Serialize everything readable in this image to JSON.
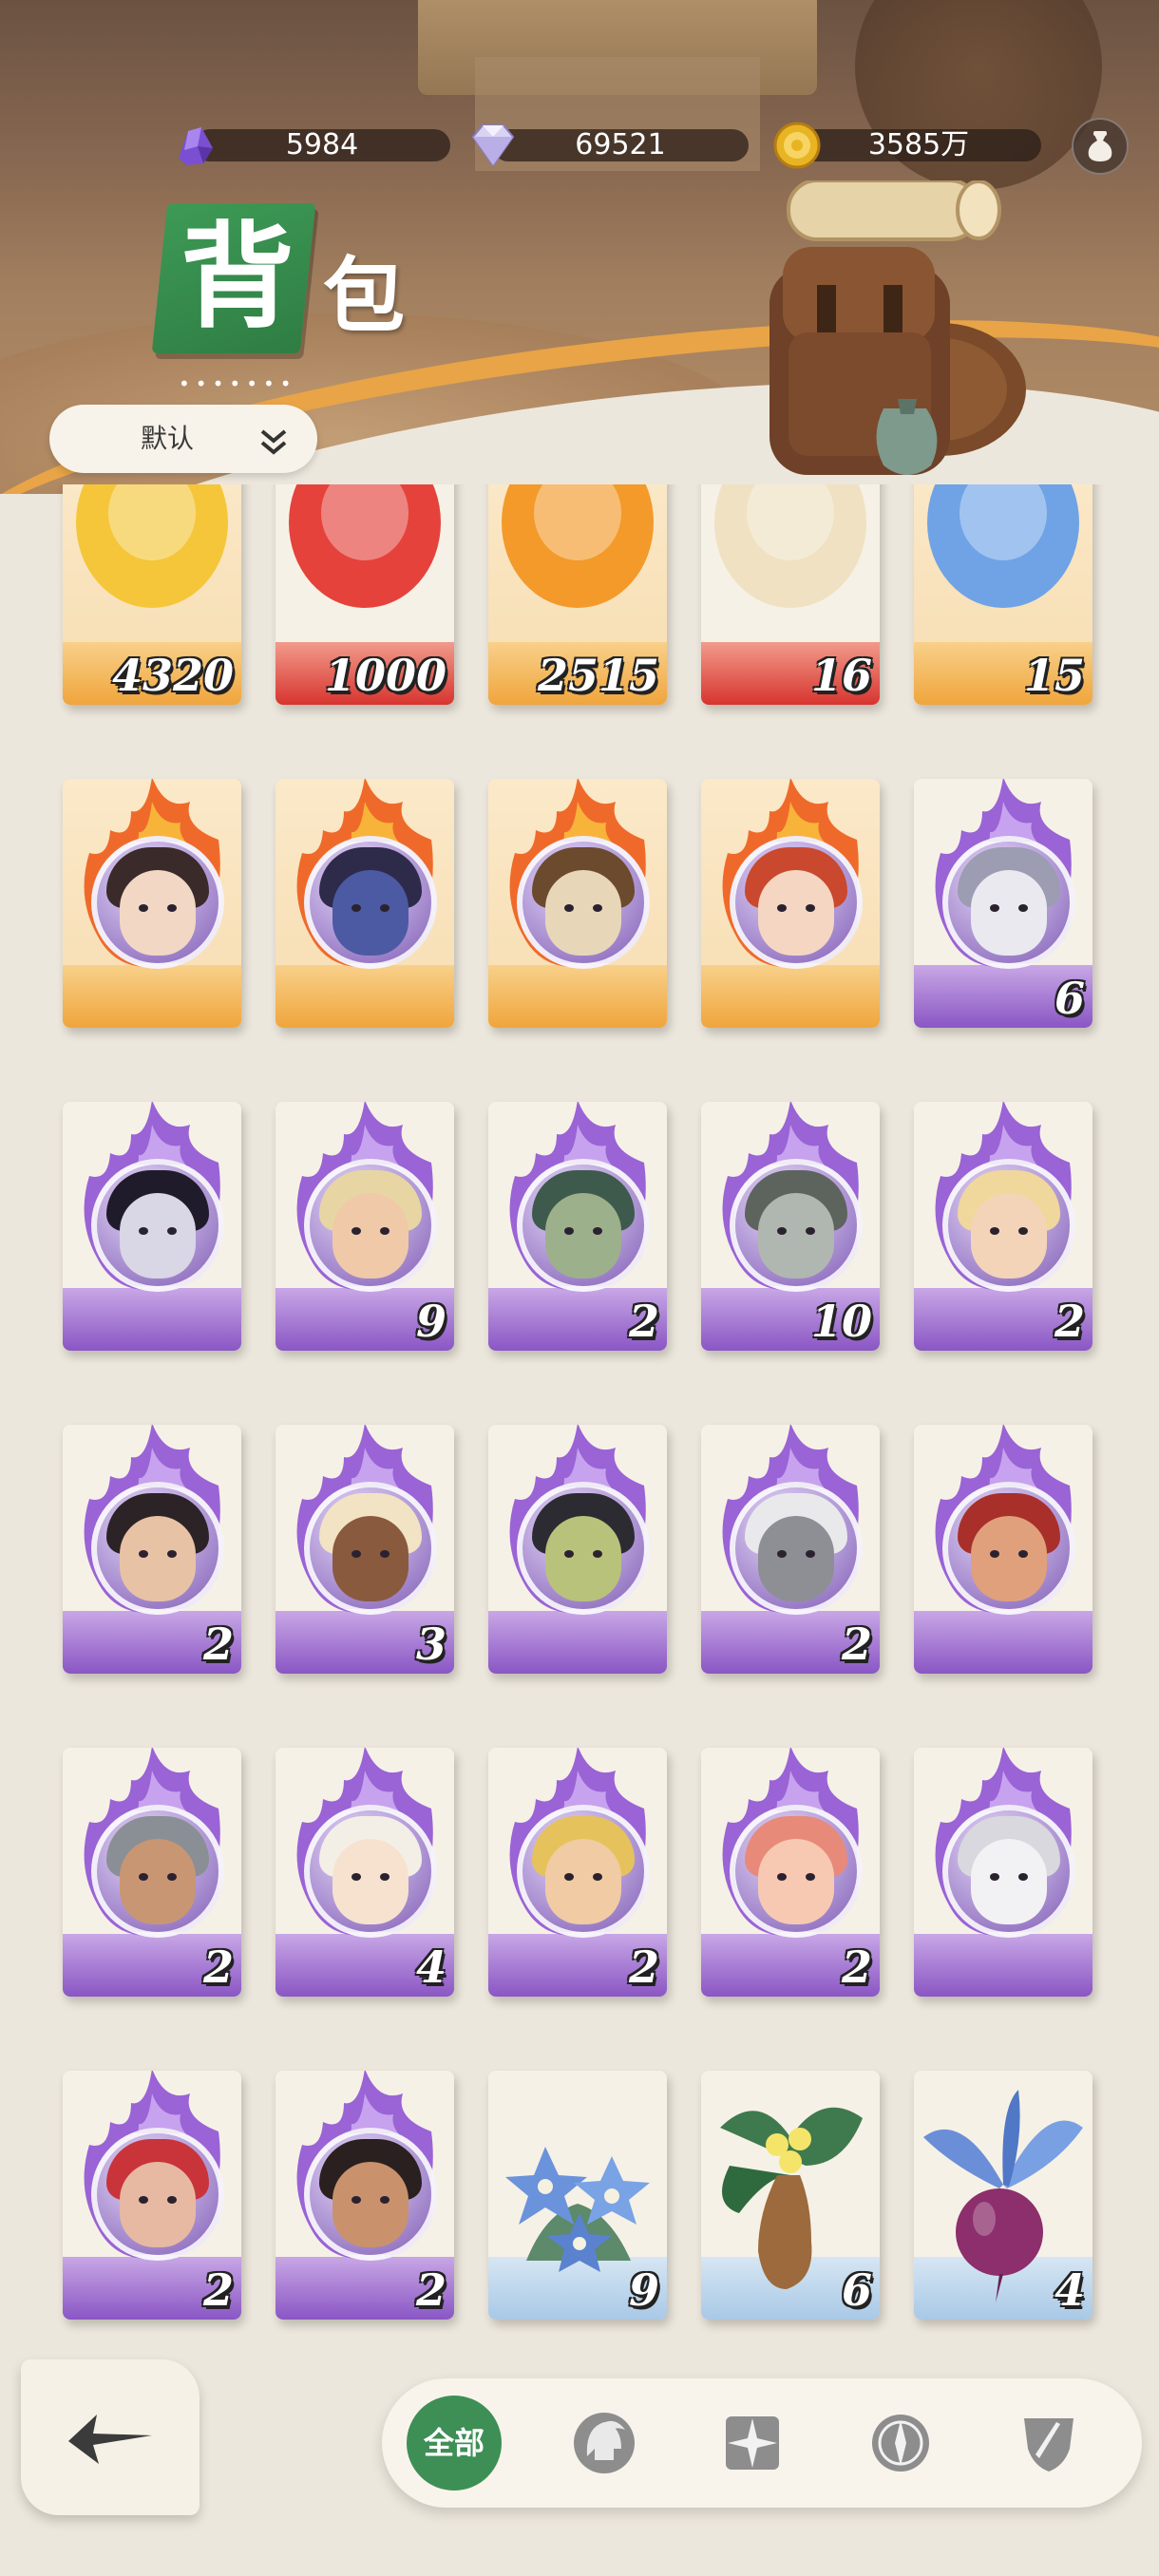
{
  "currencies": {
    "amethyst": "5984",
    "diamond": "69521",
    "gold": "3585万"
  },
  "title": {
    "char1": "背",
    "char2": "包",
    "dots": "•••••••"
  },
  "sort": {
    "label": "默认"
  },
  "items": [
    {
      "type": "potion-yellow",
      "count": "4320",
      "frame": "fire"
    },
    {
      "type": "potion-red",
      "count": "1000",
      "frame": "red"
    },
    {
      "type": "potion-orange",
      "count": "2515",
      "frame": "fire"
    },
    {
      "type": "scroll",
      "count": "16",
      "frame": "red"
    },
    {
      "type": "orb-blue",
      "count": "15",
      "frame": "fire"
    },
    {
      "type": "hero-fire",
      "count": "",
      "frame": "fire",
      "skin": "#f2d7c4",
      "hair": "#3a2a2a"
    },
    {
      "type": "hero-fire",
      "count": "",
      "frame": "fire",
      "skin": "#4c5aa3",
      "hair": "#2e2a4a"
    },
    {
      "type": "hero-fire",
      "count": "",
      "frame": "fire",
      "skin": "#e8d6b8",
      "hair": "#6b4a2e"
    },
    {
      "type": "hero-fire",
      "count": "",
      "frame": "fire",
      "skin": "#f4d6c2",
      "hair": "#c9482e"
    },
    {
      "type": "hero-purple",
      "count": "6",
      "frame": "purple",
      "skin": "#e9e9ef",
      "hair": "#9c9cb2"
    },
    {
      "type": "hero-purple",
      "count": "",
      "frame": "purple",
      "skin": "#d9d6e6",
      "hair": "#1f1b2b"
    },
    {
      "type": "hero-purple",
      "count": "9",
      "frame": "purple",
      "skin": "#f0c9a8",
      "hair": "#e7d6a3"
    },
    {
      "type": "hero-purple",
      "count": "2",
      "frame": "purple",
      "skin": "#9db08c",
      "hair": "#3e5a4c"
    },
    {
      "type": "hero-purple",
      "count": "10",
      "frame": "purple",
      "skin": "#b0b7b0",
      "hair": "#5d645e"
    },
    {
      "type": "hero-purple",
      "count": "2",
      "frame": "purple",
      "skin": "#f4d4b8",
      "hair": "#f0d79c"
    },
    {
      "type": "hero-purple",
      "count": "2",
      "frame": "purple",
      "skin": "#e8c2a4",
      "hair": "#2b2326"
    },
    {
      "type": "hero-purple",
      "count": "3",
      "frame": "purple",
      "skin": "#8a5a3e",
      "hair": "#f2e3c4"
    },
    {
      "type": "hero-purple",
      "count": "",
      "frame": "purple",
      "skin": "#b8c27a",
      "hair": "#2c2b32"
    },
    {
      "type": "hero-purple",
      "count": "2",
      "frame": "purple",
      "skin": "#8d8f95",
      "hair": "#e9e9ec"
    },
    {
      "type": "hero-purple",
      "count": "",
      "frame": "purple",
      "skin": "#e0a07c",
      "hair": "#a82f2a"
    },
    {
      "type": "hero-purple",
      "count": "2",
      "frame": "purple",
      "skin": "#c99674",
      "hair": "#8a8f96"
    },
    {
      "type": "hero-purple",
      "count": "4",
      "frame": "purple",
      "skin": "#f6e2cf",
      "hair": "#f4efe6"
    },
    {
      "type": "hero-purple",
      "count": "2",
      "frame": "purple",
      "skin": "#f0cba4",
      "hair": "#e6c25c"
    },
    {
      "type": "hero-purple",
      "count": "2",
      "frame": "purple",
      "skin": "#f7c9b2",
      "hair": "#e88a7a"
    },
    {
      "type": "hero-purple",
      "count": "",
      "frame": "purple",
      "skin": "#f2f2f4",
      "hair": "#d8d8de"
    },
    {
      "type": "hero-purple",
      "count": "2",
      "frame": "purple",
      "skin": "#e7b9a2",
      "hair": "#c8343a"
    },
    {
      "type": "hero-purple",
      "count": "2",
      "frame": "purple",
      "skin": "#c9926c",
      "hair": "#2a2020"
    },
    {
      "type": "plant-blue-flower",
      "count": "9",
      "frame": "blue"
    },
    {
      "type": "plant-mandrake",
      "count": "6",
      "frame": "blue"
    },
    {
      "type": "plant-beet",
      "count": "4",
      "frame": "blue"
    }
  ],
  "tabs": [
    {
      "label": "全部",
      "icon": "all"
    },
    {
      "label": "",
      "icon": "spartan-helmet-icon"
    },
    {
      "label": "",
      "icon": "star-compass-icon"
    },
    {
      "label": "",
      "icon": "compass-icon"
    },
    {
      "label": "",
      "icon": "sword-shield-icon"
    }
  ],
  "colors": {
    "active_tab": "#3e8f56",
    "title_green": "#3d9a56",
    "rare_purple": "#8a56c4",
    "epic_orange": "#f0a53c"
  }
}
